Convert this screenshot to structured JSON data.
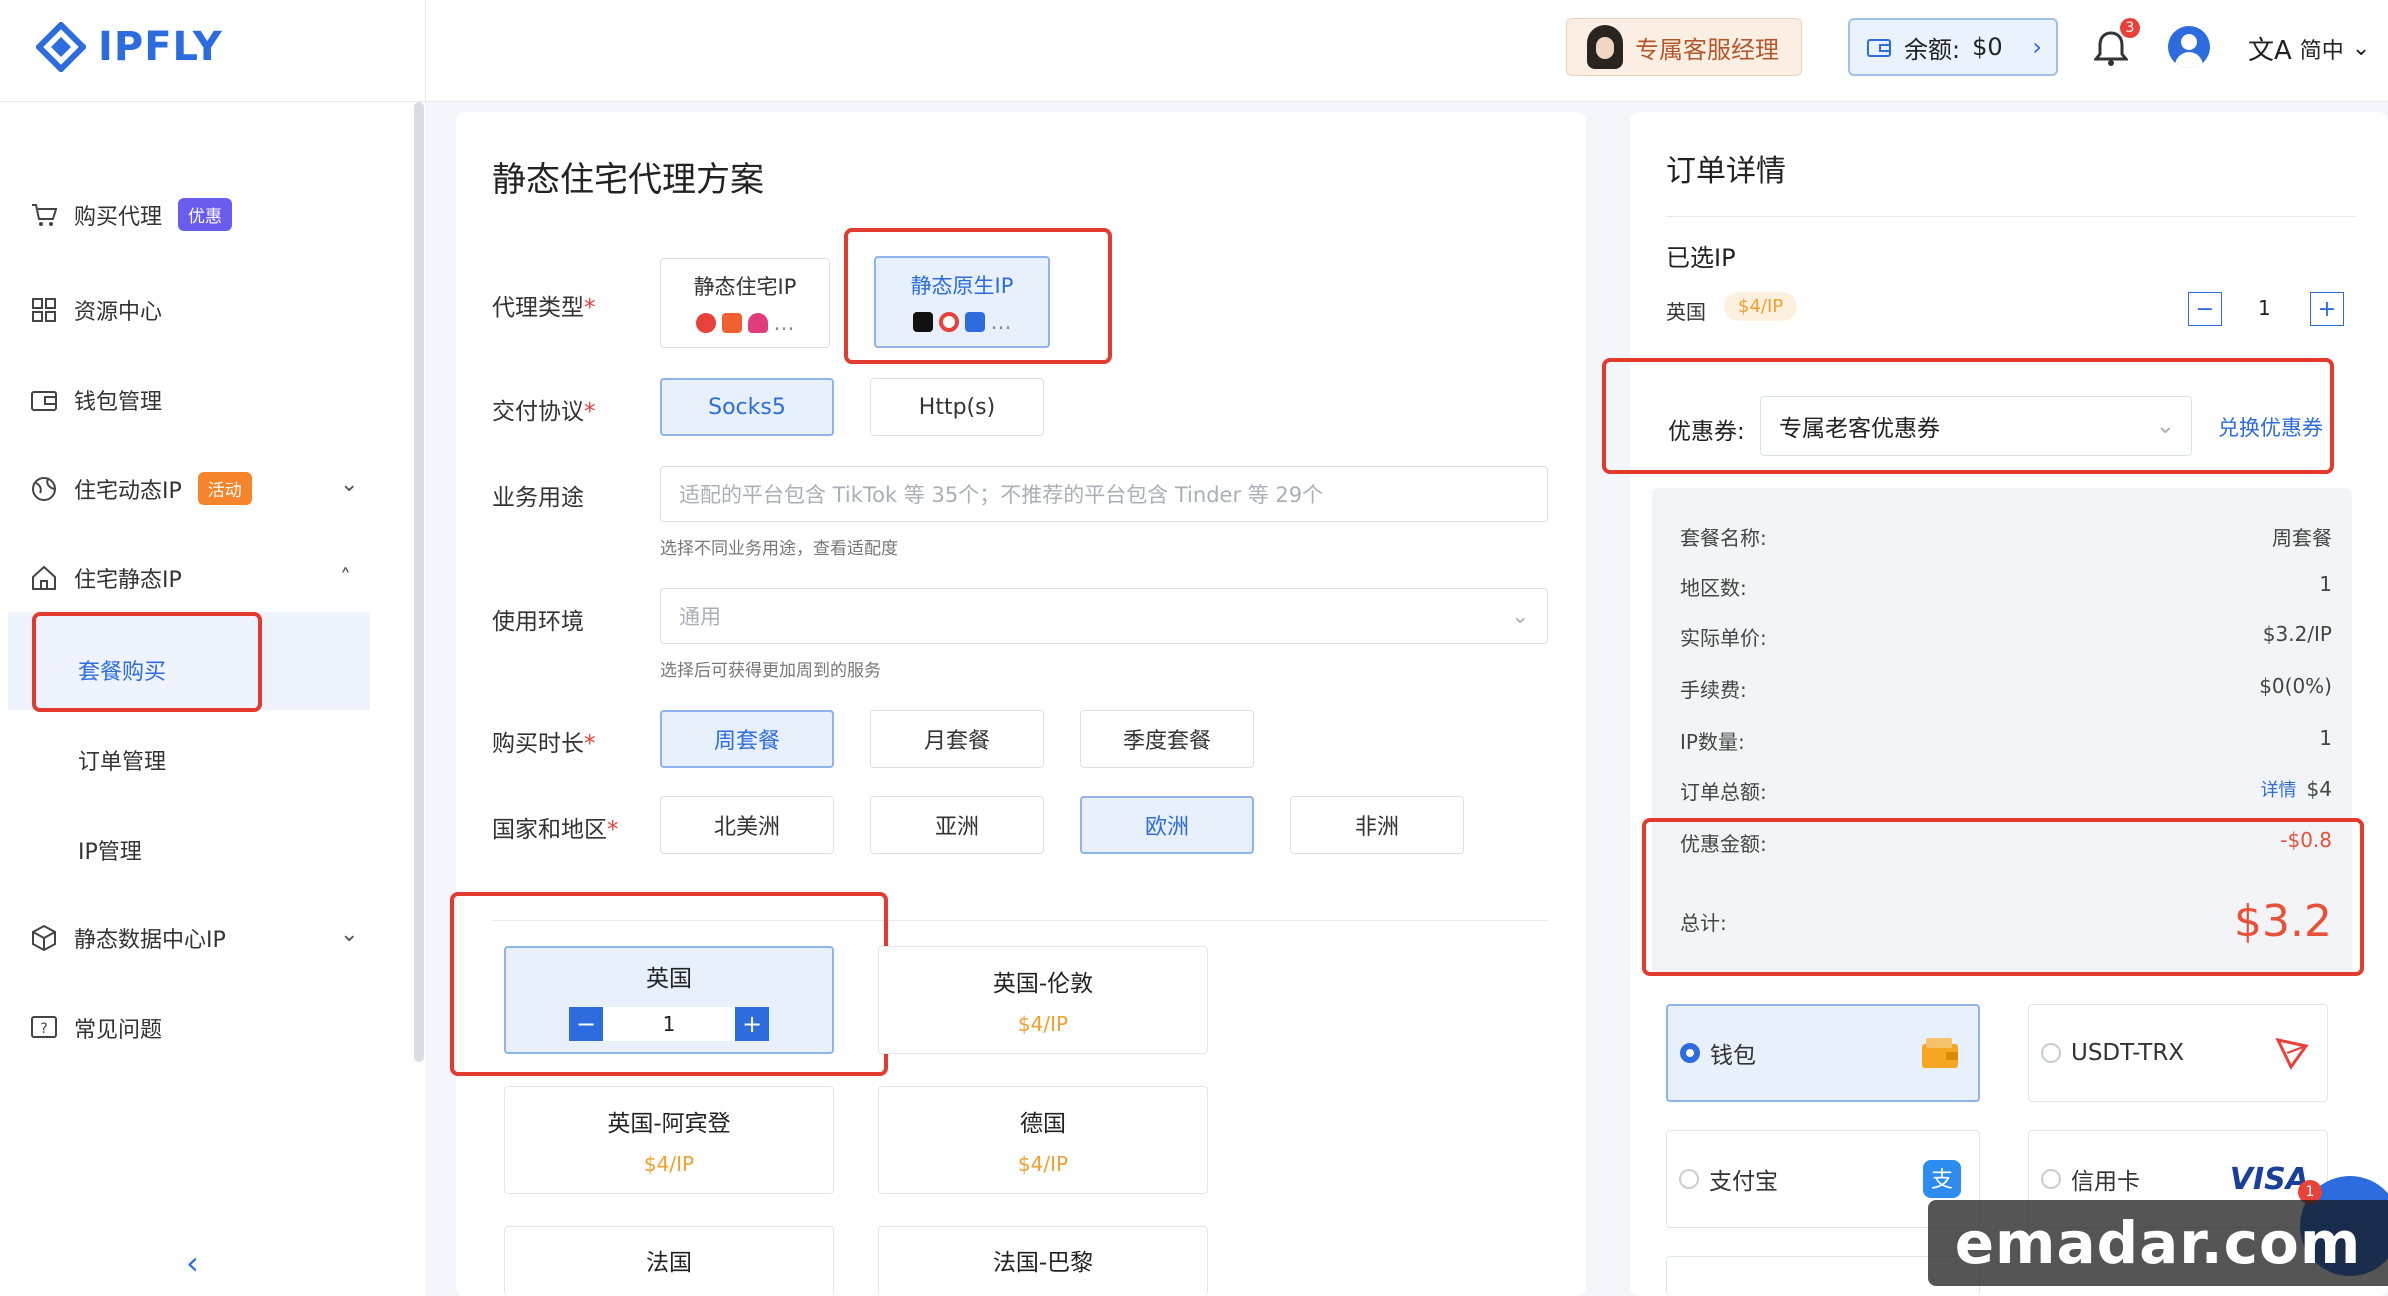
{
  "app": {
    "brand": "IPFLY"
  },
  "header": {
    "manager_label": "专属客服经理",
    "balance_label": "余额:",
    "balance_value": "$0",
    "notifications": "3",
    "language": "简中"
  },
  "sidebar": {
    "items": [
      {
        "label": "购买代理",
        "tag": "优惠"
      },
      {
        "label": "资源中心"
      },
      {
        "label": "钱包管理"
      },
      {
        "label": "住宅动态IP",
        "tag": "活动"
      },
      {
        "label": "住宅静态IP"
      },
      {
        "label": "静态数据中心IP"
      },
      {
        "label": "常见问题"
      }
    ],
    "sub_items": [
      "套餐购买",
      "订单管理",
      "IP管理"
    ]
  },
  "main": {
    "title": "静态住宅代理方案",
    "proxy_type_label": "代理类型",
    "proxy_types": [
      "静态住宅IP",
      "静态原生IP"
    ],
    "protocol_label": "交付协议",
    "protocols": [
      "Socks5",
      "Http(s)"
    ],
    "usage_label": "业务用途",
    "usage_placeholder": "适配的平台包含 TikTok 等 35个；不推荐的平台包含 Tinder 等 29个",
    "usage_hint": "选择不同业务用途，查看适配度",
    "env_label": "使用环境",
    "env_value": "通用",
    "env_hint": "选择后可获得更加周到的服务",
    "duration_label": "购买时长",
    "durations": [
      "周套餐",
      "月套餐",
      "季度套餐"
    ],
    "region_label": "国家和地区",
    "regions": [
      "北美洲",
      "亚洲",
      "欧洲",
      "非洲"
    ],
    "countries": [
      {
        "name": "英国",
        "qty": "1"
      },
      {
        "name": "英国-伦敦",
        "price": "$4/IP"
      },
      {
        "name": "英国-阿宾登",
        "price": "$4/IP"
      },
      {
        "name": "德国",
        "price": "$4/IP"
      },
      {
        "name": "法国"
      },
      {
        "name": "法国-巴黎"
      }
    ]
  },
  "order": {
    "title": "订单详情",
    "selected_label": "已选IP",
    "selected_country": "英国",
    "selected_price": "$4/IP",
    "selected_qty": "1",
    "coupon_label": "优惠券:",
    "coupon_value": "专属老客优惠券",
    "coupon_redeem": "兑换优惠券",
    "rows": [
      {
        "k": "套餐名称:",
        "v": "周套餐"
      },
      {
        "k": "地区数:",
        "v": "1"
      },
      {
        "k": "实际单价:",
        "v": "$3.2/IP"
      },
      {
        "k": "手续费:",
        "v": "$0(0%)"
      },
      {
        "k": "IP数量:",
        "v": "1"
      },
      {
        "k": "订单总额:",
        "v": "$4",
        "extra": "详情"
      },
      {
        "k": "优惠金额:",
        "v": "-$0.8"
      }
    ],
    "total_label": "总计:",
    "total_value": "$3.2",
    "payments": [
      "钱包",
      "USDT-TRX",
      "支付宝",
      "信用卡"
    ],
    "visa": "VISA"
  },
  "watermark": "emadar.com",
  "colors": {
    "accent": "#2d6cdf",
    "highlight": "#e23b2e",
    "price": "#f0a030",
    "total": "#e8503a"
  }
}
